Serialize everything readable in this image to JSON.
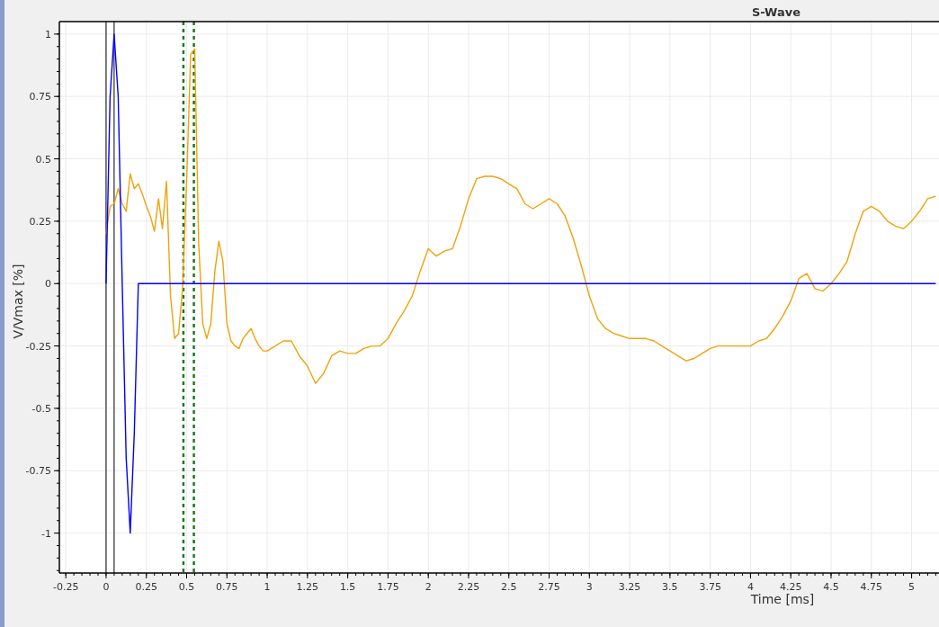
{
  "chart": {
    "chart_data": {
      "type": "line",
      "title": "S-Wave",
      "xlabel": "Time [ms]",
      "ylabel": "V/Vmax [%]",
      "x": [
        0,
        0.025,
        0.05,
        0.075,
        0.1,
        0.125,
        0.15,
        0.175,
        0.2,
        0.225,
        0.25,
        0.275,
        0.3,
        0.325,
        0.35,
        0.375,
        0.4,
        0.425,
        0.45,
        0.475,
        0.5,
        0.525,
        0.55,
        0.575,
        0.6,
        0.625,
        0.65,
        0.675,
        0.7,
        0.725,
        0.75,
        0.775,
        0.8,
        0.825,
        0.85,
        0.875,
        0.9,
        0.925,
        0.95,
        0.975,
        1,
        1.05,
        1.1,
        1.15,
        1.2,
        1.25,
        1.3,
        1.35,
        1.4,
        1.45,
        1.5,
        1.55,
        1.6,
        1.65,
        1.7,
        1.75,
        1.8,
        1.85,
        1.9,
        1.95,
        2,
        2.05,
        2.1,
        2.15,
        2.2,
        2.25,
        2.3,
        2.35,
        2.4,
        2.45,
        2.5,
        2.55,
        2.6,
        2.65,
        2.7,
        2.75,
        2.8,
        2.85,
        2.9,
        2.95,
        3,
        3.05,
        3.1,
        3.15,
        3.2,
        3.25,
        3.3,
        3.35,
        3.4,
        3.45,
        3.5,
        3.55,
        3.6,
        3.65,
        3.7,
        3.75,
        3.8,
        3.85,
        3.9,
        3.95,
        4,
        4.05,
        4.1,
        4.15,
        4.2,
        4.25,
        4.3,
        4.35,
        4.4,
        4.45,
        4.5,
        4.55,
        4.6,
        4.65,
        4.7,
        4.75,
        4.8,
        4.85,
        4.9,
        4.95,
        5,
        5.05,
        5.1,
        5.15
      ],
      "series": [
        {
          "color": "#f0a30a",
          "values": [
            0.2,
            0.31,
            0.32,
            0.38,
            0.32,
            0.29,
            0.44,
            0.38,
            0.4,
            0.36,
            0.31,
            0.27,
            0.21,
            0.34,
            0.22,
            0.41,
            -0.05,
            -0.22,
            -0.2,
            -0.02,
            0.41,
            0.92,
            0.94,
            0.16,
            -0.16,
            -0.22,
            -0.16,
            0.05,
            0.17,
            0.09,
            -0.16,
            -0.23,
            -0.25,
            -0.26,
            -0.22,
            -0.2,
            -0.18,
            -0.22,
            -0.25,
            -0.27,
            -0.27,
            -0.25,
            -0.23,
            -0.23,
            -0.29,
            -0.33,
            -0.4,
            -0.36,
            -0.29,
            -0.27,
            -0.28,
            -0.28,
            -0.26,
            -0.25,
            -0.25,
            -0.22,
            -0.16,
            -0.11,
            -0.05,
            0.05,
            0.14,
            0.11,
            0.13,
            0.14,
            0.23,
            0.34,
            0.42,
            0.43,
            0.43,
            0.42,
            0.4,
            0.38,
            0.32,
            0.3,
            0.32,
            0.34,
            0.32,
            0.27,
            0.18,
            0.07,
            -0.05,
            -0.14,
            -0.18,
            -0.2,
            -0.21,
            -0.22,
            -0.22,
            -0.22,
            -0.23,
            -0.25,
            -0.27,
            -0.29,
            -0.31,
            -0.3,
            -0.28,
            -0.26,
            -0.25,
            -0.25,
            -0.25,
            -0.25,
            -0.25,
            -0.23,
            -0.22,
            -0.18,
            -0.13,
            -0.07,
            0.02,
            0.04,
            -0.02,
            -0.03,
            0,
            0.04,
            0.09,
            0.2,
            0.29,
            0.31,
            0.29,
            0.25,
            0.23,
            0.22,
            0.25,
            0.29,
            0.34,
            0.35
          ]
        },
        {
          "color": "#0000ff",
          "values": [
            0,
            0.75,
            1,
            0.75,
            0,
            -0.7,
            -1,
            -0.6,
            0,
            0,
            0,
            0,
            0,
            0,
            0,
            0,
            0,
            0,
            0,
            0,
            0,
            0,
            0,
            0,
            0,
            0,
            0,
            0,
            0,
            0,
            0,
            0,
            0,
            0,
            0,
            0,
            0,
            0,
            0,
            0,
            0,
            0,
            0,
            0,
            0,
            0,
            0,
            0,
            0,
            0,
            0,
            0,
            0,
            0,
            0,
            0,
            0,
            0,
            0,
            0,
            0,
            0,
            0,
            0,
            0,
            0,
            0,
            0,
            0,
            0,
            0,
            0,
            0,
            0,
            0,
            0,
            0,
            0,
            0,
            0,
            0,
            0,
            0,
            0,
            0,
            0,
            0,
            0,
            0,
            0,
            0,
            0,
            0,
            0,
            0,
            0,
            0,
            0,
            0,
            0,
            0,
            0,
            0,
            0,
            0,
            0,
            0,
            0,
            0,
            0,
            0,
            0,
            0,
            0,
            0,
            0,
            0,
            0,
            0,
            0,
            0,
            0,
            0,
            0
          ]
        }
      ],
      "xlim": [
        -0.29,
        5.17
      ],
      "ylim": [
        -1.16,
        1.05
      ],
      "xticks": [
        {
          "value": -0.25,
          "label": "-0.25"
        },
        {
          "value": 0,
          "label": "0"
        },
        {
          "value": 0.25,
          "label": "0.25"
        },
        {
          "value": 0.5,
          "label": "0.5"
        },
        {
          "value": 0.75,
          "label": "0.75"
        },
        {
          "value": 1,
          "label": "1"
        },
        {
          "value": 1.25,
          "label": "1.25"
        },
        {
          "value": 1.5,
          "label": "1.5"
        },
        {
          "value": 1.75,
          "label": "1.75"
        },
        {
          "value": 2,
          "label": "2"
        },
        {
          "value": 2.25,
          "label": "2.25"
        },
        {
          "value": 2.5,
          "label": "2.5"
        },
        {
          "value": 2.75,
          "label": "2.75"
        },
        {
          "value": 3,
          "label": "3"
        },
        {
          "value": 3.25,
          "label": "3.25"
        },
        {
          "value": 3.5,
          "label": "3.5"
        },
        {
          "value": 3.75,
          "label": "3.75"
        },
        {
          "value": 4,
          "label": "4"
        },
        {
          "value": 4.25,
          "label": "4.25"
        },
        {
          "value": 4.5,
          "label": "4.5"
        },
        {
          "value": 4.75,
          "label": "4.75"
        },
        {
          "value": 5,
          "label": "5"
        }
      ],
      "yticks": [
        {
          "value": -1,
          "label": "-1"
        },
        {
          "value": -0.75,
          "label": "-0.75"
        },
        {
          "value": -0.5,
          "label": "-0.5"
        },
        {
          "value": -0.25,
          "label": "-0.25"
        },
        {
          "value": 0,
          "label": "0"
        },
        {
          "value": 0.25,
          "label": "0.25"
        },
        {
          "value": 0.5,
          "label": "0.5"
        },
        {
          "value": 0.75,
          "label": "0.75"
        },
        {
          "value": 1,
          "label": "1"
        }
      ],
      "grid": true,
      "ref_lines": [
        {
          "axis": "x",
          "value": 0,
          "color": "#000000"
        },
        {
          "axis": "x",
          "value": 0.05,
          "color": "#000000"
        },
        {
          "axis": "x",
          "value": 0.48,
          "color": "#1a7a1a"
        },
        {
          "axis": "x",
          "value": 0.545,
          "color": "#1a7a1a"
        }
      ]
    }
  }
}
